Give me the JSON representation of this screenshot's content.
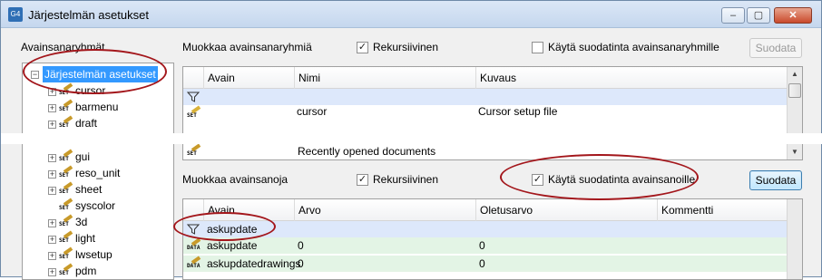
{
  "window": {
    "app_icon_text": "G4",
    "title": "Järjestelmän asetukset",
    "minimize": "–",
    "maximize": "▢",
    "close": "✕"
  },
  "left_panel": {
    "label": "Avainsanaryhmät",
    "tree": {
      "root": "Järjestelmän asetukset",
      "items": [
        "cursor",
        "barmenu",
        "draft",
        "gui",
        "reso_unit",
        "sheet",
        "syscolor",
        "3d",
        "light",
        "lwsetup",
        "pdm"
      ]
    }
  },
  "groups_panel": {
    "label": "Muokkaa avainsanaryhmiä",
    "recursive_label": "Rekursiivinen",
    "recursive_checked": true,
    "filter_label": "Käytä suodatinta avainsanaryhmille",
    "filter_checked": false,
    "filter_button": "Suodata",
    "columns": [
      "Avain",
      "Nimi",
      "Kuvaus"
    ],
    "rows": [
      {
        "key": "",
        "name": "",
        "description": ""
      },
      {
        "key": "",
        "name": "cursor",
        "description": "Cursor setup file"
      },
      {
        "key": "",
        "name": "Recently opened documents",
        "description": ""
      }
    ]
  },
  "keywords_panel": {
    "label": "Muokkaa avainsanoja",
    "recursive_label": "Rekursiivinen",
    "recursive_checked": true,
    "filter_label": "Käytä suodatinta avainsanoille",
    "filter_checked": true,
    "filter_button": "Suodata",
    "columns": [
      "Avain",
      "Arvo",
      "Oletusarvo",
      "Kommentti"
    ],
    "filter_value": "askupdate",
    "rows": [
      {
        "key": "askupdate",
        "value": "0",
        "default": "0",
        "comment": ""
      },
      {
        "key": "askupdatedrawings",
        "value": "0",
        "default": "0",
        "comment": ""
      }
    ]
  },
  "icons": {
    "checkmark": "✓",
    "filter": "funnel-icon",
    "set": "set-icon",
    "data": "data-icon",
    "expand": "+",
    "collapse": "−"
  },
  "colors": {
    "selection": "#3399ff",
    "filter_row": "#dde8fb",
    "data_row": "#e3f4e5",
    "annotation": "#a3161b"
  }
}
